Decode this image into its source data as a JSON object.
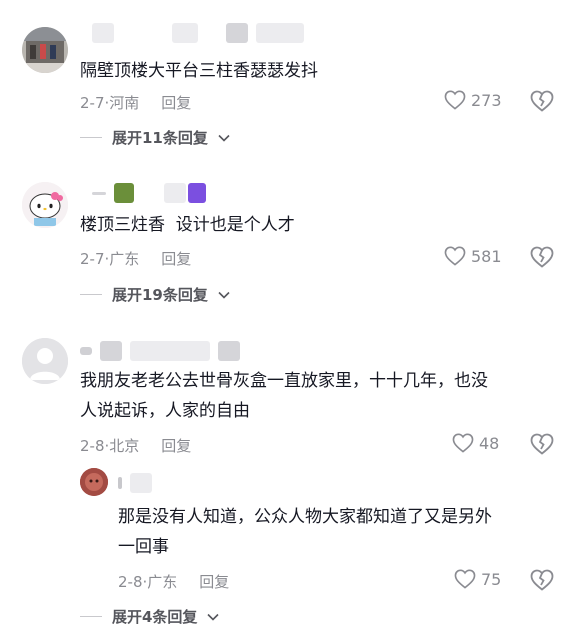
{
  "comments": [
    {
      "text": "隔壁顶楼大平台三柱香瑟瑟发抖",
      "date": "2-7",
      "location": "河南",
      "reply_label": "回复",
      "likes": "273",
      "expand_label": "展开11条回复"
    },
    {
      "text": "楼顶三炷香  设计也是个人才",
      "date": "2-7",
      "location": "广东",
      "reply_label": "回复",
      "likes": "581",
      "expand_label": "展开19条回复"
    },
    {
      "text": "我朋友老老公去世骨灰盒一直放家里，十十几年，也没\n人说起诉，人家的自由",
      "date": "2-8",
      "location": "北京",
      "reply_label": "回复",
      "likes": "48",
      "reply": {
        "text": "那是没有人知道，公众人物大家都知道了又是另外\n一回事",
        "date": "2-8",
        "location": "广东",
        "reply_label": "回复",
        "likes": "75"
      },
      "expand_label": "展开4条回复"
    }
  ],
  "separator": "·",
  "icons": {
    "like": "heart-outline-icon",
    "dislike": "broken-heart-icon",
    "expand": "chevron-down-icon"
  },
  "colors": {
    "text": "#161823",
    "meta": "#8a8b91",
    "purple_badge": "#7b4fe0",
    "green_badge": "#6b8f3a"
  }
}
